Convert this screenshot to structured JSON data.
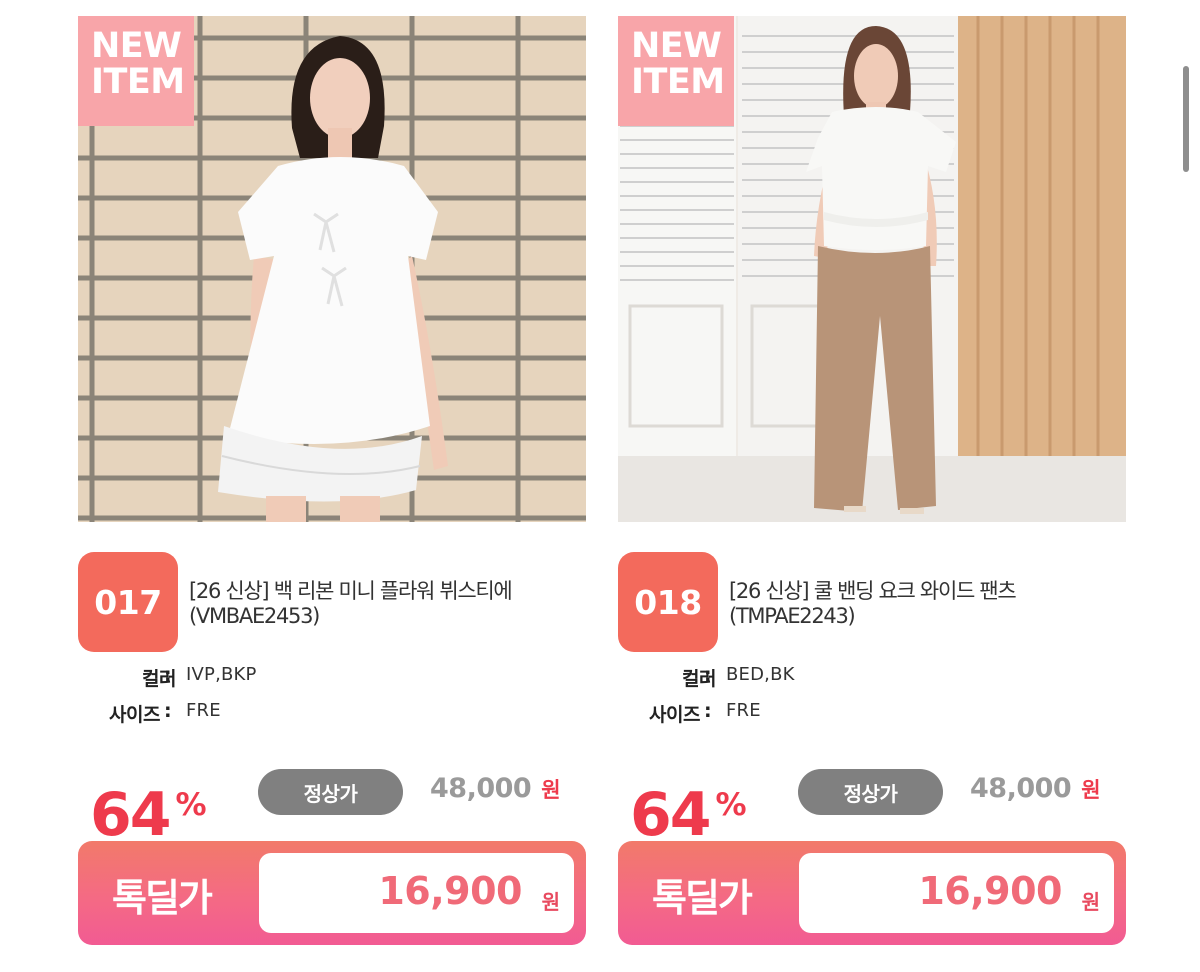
{
  "products": [
    {
      "badge": "NEW ITEM",
      "badge_lines": [
        "NEW",
        "ITEM"
      ],
      "number": "017",
      "title_line1": "[26 신상] 백 리본 미니 플라워 뷔스티에",
      "title_line2": "(VMBAE2453)",
      "color_label": "컬러",
      "color_value": "IVP,BKP",
      "size_label": "사이즈",
      "size_value": "FRE",
      "discount_value": "64",
      "discount_unit": "%",
      "regular_label": "정상가",
      "regular_price": "48,000",
      "currency": "원",
      "deal_label": "톡딜가",
      "deal_price": "16,900",
      "image_icon": "product-photo-white-blouse"
    },
    {
      "badge": "NEW ITEM",
      "badge_lines": [
        "NEW",
        "ITEM"
      ],
      "number": "018",
      "title_line1": "[26 신상] 쿨 밴딩 요크 와이드 팬츠",
      "title_line2": "(TMPAE2243)",
      "color_label": "컬러",
      "color_value": "BED,BK",
      "size_label": "사이즈",
      "size_value": "FRE",
      "discount_value": "64",
      "discount_unit": "%",
      "regular_label": "정상가",
      "regular_price": "48,000",
      "currency": "원",
      "deal_label": "톡딜가",
      "deal_price": "16,900",
      "image_icon": "product-photo-wide-pants"
    }
  ],
  "colors": {
    "badge_new": "#f8a5a9",
    "badge_number": "#f36a5c",
    "discount": "#ee3a4c",
    "regular_pill": "#808080",
    "deal_gradient_top": "#f27a6a",
    "deal_gradient_bottom": "#f25b93"
  }
}
